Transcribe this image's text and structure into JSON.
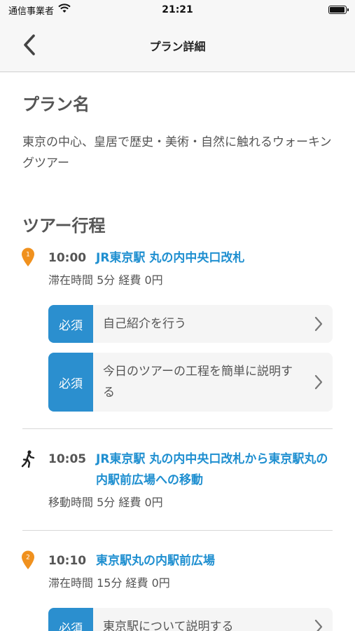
{
  "status": {
    "carrier": "通信事業者",
    "time": "21:21",
    "battery_level": 0.95
  },
  "nav": {
    "title": "プラン詳細"
  },
  "plan": {
    "heading": "プラン名",
    "name": "東京の中心、皇居で歴史・美術・自然に触れるウォーキングツアー"
  },
  "tour": {
    "heading": "ツアー行程",
    "stops": [
      {
        "badge": "1",
        "time": "10:00",
        "name": "JR東京駅 丸の内中央口改札",
        "meta": "滞在時間 5分  経費 0円",
        "tasks": [
          {
            "badge": "必須",
            "text": "自己紹介を行う"
          },
          {
            "badge": "必須",
            "text": "今日のツアーの工程を簡単に説明する"
          }
        ]
      },
      {
        "time": "10:05",
        "name": "JR東京駅 丸の内中央口改札から東京駅丸の内駅前広場への移動",
        "meta": "移動時間 5分  経費 0円"
      },
      {
        "badge": "2",
        "time": "10:10",
        "name": "東京駅丸の内駅前広場",
        "meta": "滞在時間 15分  経費 0円",
        "tasks": [
          {
            "badge": "必須",
            "text": "東京駅について説明する"
          }
        ]
      }
    ]
  },
  "colors": {
    "accent": "#1f8fd0",
    "badge": "#2b8fcf",
    "pin": "#f0911e"
  }
}
